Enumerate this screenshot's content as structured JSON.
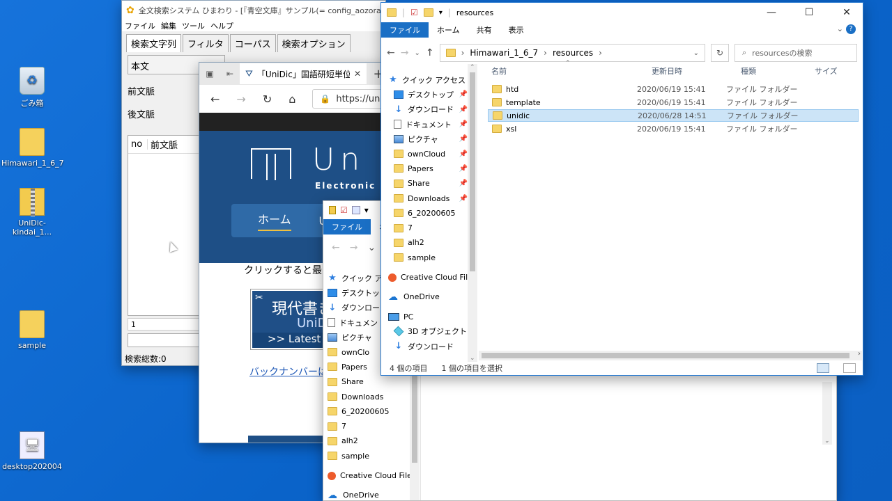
{
  "desktop": {
    "icons": [
      {
        "label": "ごみ箱",
        "icon": "recycle-bin-icon"
      },
      {
        "label": "Himawari_1_6_7",
        "icon": "folder-icon"
      },
      {
        "label": "UniDic-kindai_1...",
        "icon": "zip-folder-icon"
      },
      {
        "label": "sample",
        "icon": "folder-icon"
      },
      {
        "label": "desktop202004",
        "icon": "file-icon"
      }
    ]
  },
  "himawari": {
    "title": "全文検索システム ひまわり - [『青空文庫』サンプル(= config_aozora_sample.xml",
    "menu": [
      "ファイル",
      "編集",
      "ツール",
      "ヘルプ"
    ],
    "tabs": [
      "検索文字列",
      "フィルタ",
      "コーパス",
      "検索オプション"
    ],
    "field_main": "本文",
    "label_prev": "前文脈",
    "label_next": "後文脈",
    "col_no": "no",
    "col_prev": "前文脈",
    "page_num": "1",
    "status": "検索総数:0"
  },
  "browser": {
    "tab_title": "「UniDic」国語研短単位自",
    "url": "https://unidic.",
    "site_title": "Un",
    "site_subtitle": "Electronic D",
    "nav_home": "ホーム",
    "nav_unidic": "Uni",
    "body_text": "クリックすると最",
    "banner_line1": "現代書き",
    "banner_line2": "UniD",
    "banner_line3": ">> Latest v",
    "back_number_link": "バックナンバーは"
  },
  "explorer_back": {
    "ribbon": [
      "ファイル",
      "ホーム"
    ],
    "nav": [
      {
        "label": "クイック ア",
        "icon": "star-icon"
      },
      {
        "label": "デスクトッ",
        "icon": "desktop-icon"
      },
      {
        "label": "ダウンロー",
        "icon": "download-icon"
      },
      {
        "label": "ドキュメン",
        "icon": "document-icon"
      },
      {
        "label": "ピクチャ",
        "icon": "picture-icon"
      },
      {
        "label": "ownClo",
        "icon": "folder-icon"
      },
      {
        "label": "Papers",
        "icon": "folder-icon"
      },
      {
        "label": "Share",
        "icon": "folder-icon"
      },
      {
        "label": "Downloads",
        "icon": "folder-icon"
      },
      {
        "label": "6_20200605",
        "icon": "folder-icon"
      },
      {
        "label": "7",
        "icon": "folder-icon"
      },
      {
        "label": "alh2",
        "icon": "folder-icon"
      },
      {
        "label": "sample",
        "icon": "folder-icon"
      },
      {
        "label": "Creative Cloud File",
        "icon": "creative-cloud-icon"
      },
      {
        "label": "OneDrive",
        "icon": "cloud-icon"
      }
    ]
  },
  "explorer_front": {
    "title": "resources",
    "ribbon": [
      "ファイル",
      "ホーム",
      "共有",
      "表示"
    ],
    "breadcrumb": [
      "Himawari_1_6_7",
      "resources"
    ],
    "search_placeholder": "resourcesの検索",
    "columns": {
      "name": "名前",
      "date": "更新日時",
      "type": "種類",
      "size": "サイズ"
    },
    "nav": [
      {
        "label": "クイック アクセス",
        "icon": "star-icon",
        "pinned": false,
        "indent": 0
      },
      {
        "label": "デスクトップ",
        "icon": "desktop-icon",
        "pinned": true,
        "indent": 1
      },
      {
        "label": "ダウンロード",
        "icon": "download-icon",
        "pinned": true,
        "indent": 1
      },
      {
        "label": "ドキュメント",
        "icon": "document-icon",
        "pinned": true,
        "indent": 1
      },
      {
        "label": "ピクチャ",
        "icon": "picture-icon",
        "pinned": true,
        "indent": 1
      },
      {
        "label": "ownCloud",
        "icon": "folder-icon",
        "pinned": true,
        "indent": 1
      },
      {
        "label": "Papers",
        "icon": "folder-icon",
        "pinned": true,
        "indent": 1
      },
      {
        "label": "Share",
        "icon": "folder-icon",
        "pinned": true,
        "indent": 1
      },
      {
        "label": "Downloads",
        "icon": "folder-icon",
        "pinned": true,
        "indent": 1
      },
      {
        "label": "6_20200605",
        "icon": "folder-icon",
        "pinned": false,
        "indent": 1
      },
      {
        "label": "7",
        "icon": "folder-icon",
        "pinned": false,
        "indent": 1
      },
      {
        "label": "alh2",
        "icon": "folder-icon",
        "pinned": false,
        "indent": 1
      },
      {
        "label": "sample",
        "icon": "folder-icon",
        "pinned": false,
        "indent": 1
      },
      {
        "label": "Creative Cloud File",
        "icon": "creative-cloud-icon",
        "pinned": false,
        "indent": 0
      },
      {
        "label": "OneDrive",
        "icon": "cloud-icon",
        "pinned": false,
        "indent": 0
      },
      {
        "label": "PC",
        "icon": "pc-icon",
        "pinned": false,
        "indent": 0
      },
      {
        "label": "3D オブジェクト",
        "icon": "3d-objects-icon",
        "pinned": false,
        "indent": 1
      },
      {
        "label": "ダウンロード",
        "icon": "download-icon",
        "pinned": false,
        "indent": 1
      }
    ],
    "files": [
      {
        "name": "htd",
        "date": "2020/06/19 15:41",
        "type": "ファイル フォルダー",
        "selected": false
      },
      {
        "name": "template",
        "date": "2020/06/19 15:41",
        "type": "ファイル フォルダー",
        "selected": false
      },
      {
        "name": "unidic",
        "date": "2020/06/28 14:51",
        "type": "ファイル フォルダー",
        "selected": true
      },
      {
        "name": "xsl",
        "date": "2020/06/19 15:41",
        "type": "ファイル フォルダー",
        "selected": false
      }
    ],
    "status_count": "4 個の項目",
    "status_selected": "1 個の項目を選択"
  }
}
